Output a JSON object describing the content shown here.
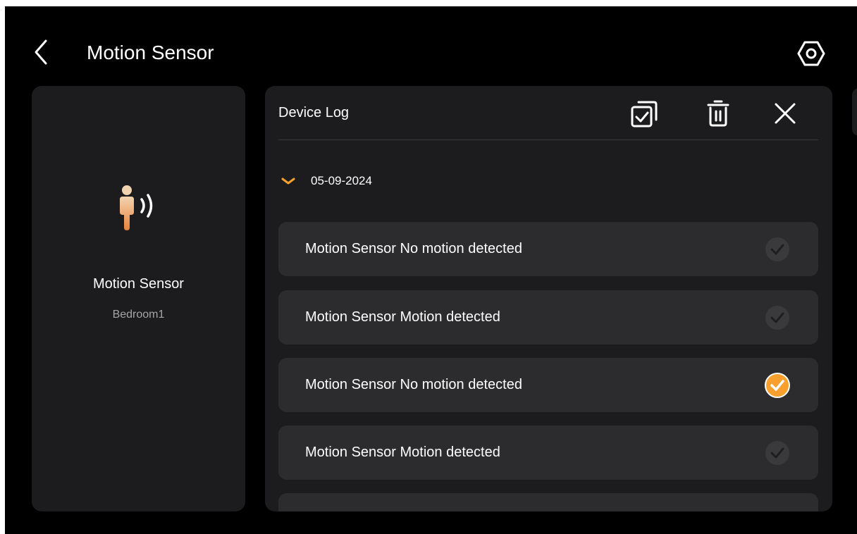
{
  "header": {
    "title": "Motion Sensor",
    "back_icon": "chevron-left-icon",
    "settings_icon": "hexagon-settings-icon"
  },
  "device": {
    "name": "Motion Sensor",
    "room": "Bedroom1",
    "icon": "motion-sensor-person-icon"
  },
  "log": {
    "title": "Device Log",
    "toolbar": {
      "select_all_icon": "select-all-icon",
      "delete_icon": "trash-icon",
      "close_icon": "close-icon"
    },
    "date_group": {
      "date": "05-09-2024",
      "expanded": true
    },
    "entries": [
      {
        "text": "Motion Sensor No motion detected",
        "checked": false
      },
      {
        "text": "Motion Sensor Motion detected",
        "checked": false
      },
      {
        "text": "Motion Sensor No motion detected",
        "checked": true
      },
      {
        "text": "Motion Sensor Motion detected",
        "checked": false
      }
    ]
  },
  "colors": {
    "background": "#000000",
    "panel": "#1c1c1e",
    "item": "#2c2c2e",
    "accent": "#f7a02e",
    "muted_check": "#3a3a3c"
  }
}
